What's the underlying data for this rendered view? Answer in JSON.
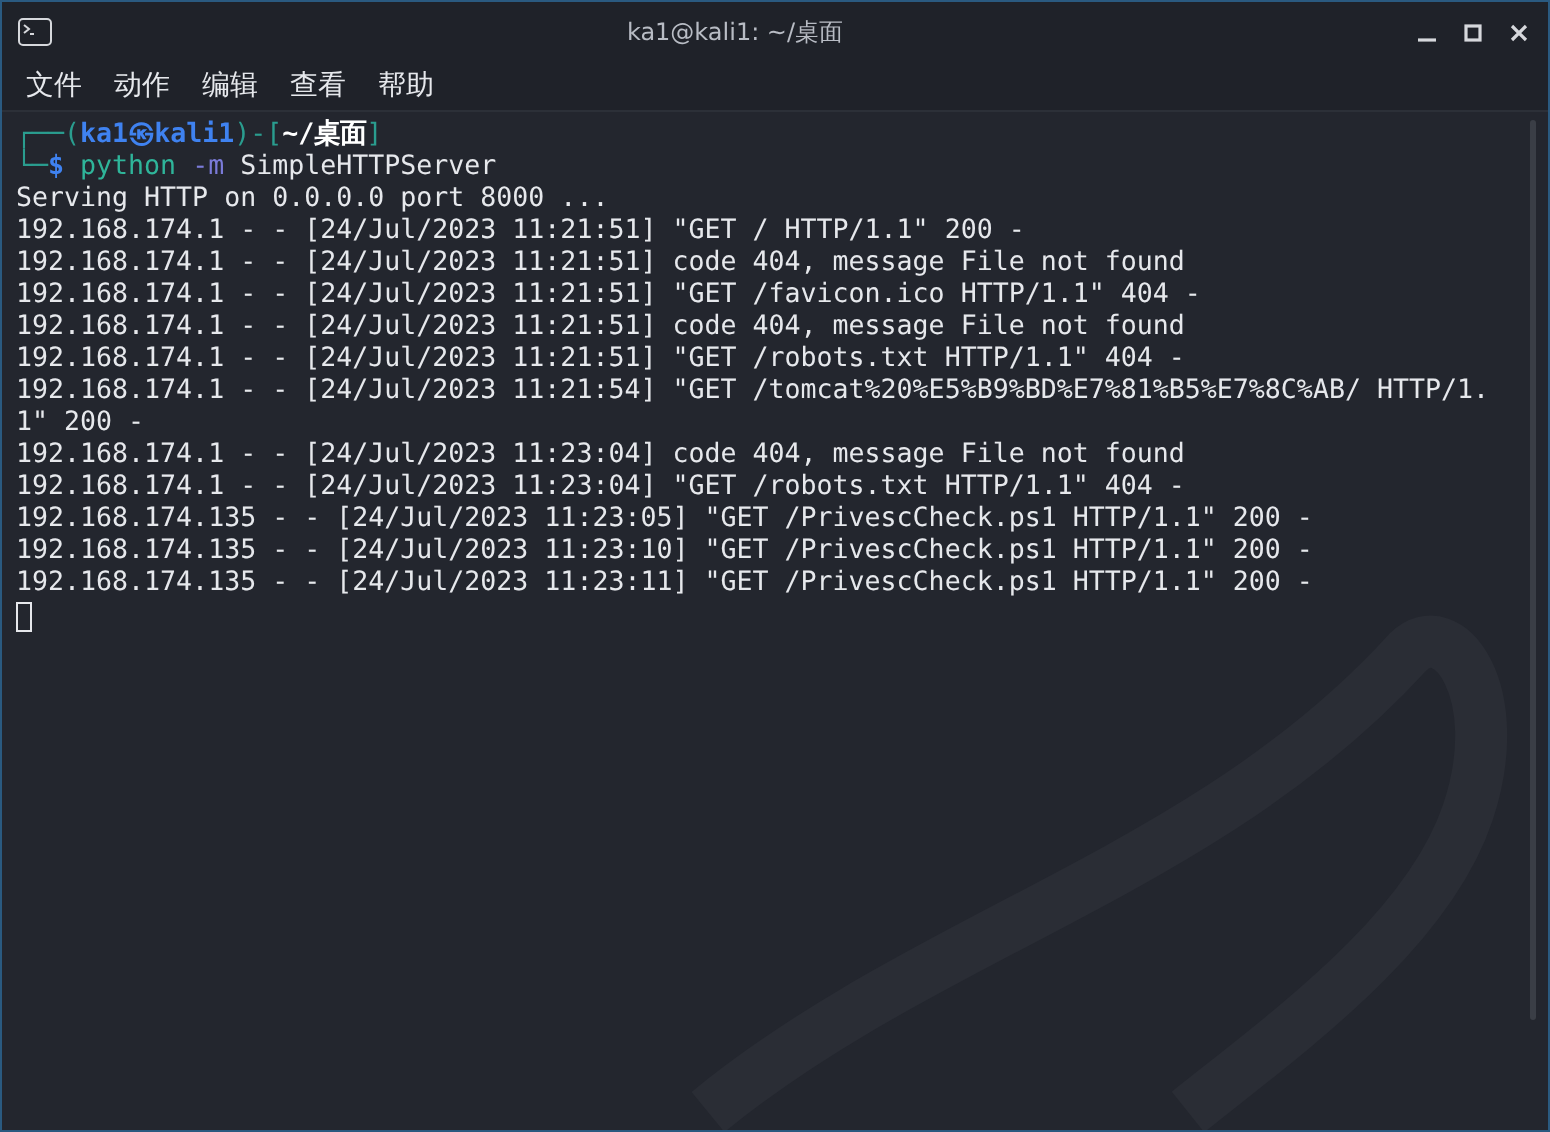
{
  "window": {
    "title": "ka1@kali1: ~/桌面"
  },
  "menu": [
    "文件",
    "动作",
    "编辑",
    "查看",
    "帮助"
  ],
  "prompt": {
    "open": "┌──(",
    "user": "ka1",
    "separator": "㉿",
    "host": "kali1",
    "middle": ")-[",
    "path": "~/桌面",
    "close": "]",
    "corner": "└─",
    "symbol": "$"
  },
  "command": {
    "program": "python",
    "option": "-m",
    "argument": "SimpleHTTPServer"
  },
  "output": [
    "Serving HTTP on 0.0.0.0 port 8000 ...",
    "192.168.174.1 - - [24/Jul/2023 11:21:51] \"GET / HTTP/1.1\" 200 -",
    "192.168.174.1 - - [24/Jul/2023 11:21:51] code 404, message File not found",
    "192.168.174.1 - - [24/Jul/2023 11:21:51] \"GET /favicon.ico HTTP/1.1\" 404 -",
    "192.168.174.1 - - [24/Jul/2023 11:21:51] code 404, message File not found",
    "192.168.174.1 - - [24/Jul/2023 11:21:51] \"GET /robots.txt HTTP/1.1\" 404 -",
    "192.168.174.1 - - [24/Jul/2023 11:21:54] \"GET /tomcat%20%E5%B9%BD%E7%81%B5%E7%8C%AB/ HTTP/1.",
    "1\" 200 -",
    "192.168.174.1 - - [24/Jul/2023 11:23:04] code 404, message File not found",
    "192.168.174.1 - - [24/Jul/2023 11:23:04] \"GET /robots.txt HTTP/1.1\" 404 -",
    "192.168.174.135 - - [24/Jul/2023 11:23:05] \"GET /PrivescCheck.ps1 HTTP/1.1\" 200 -",
    "192.168.174.135 - - [24/Jul/2023 11:23:10] \"GET /PrivescCheck.ps1 HTTP/1.1\" 200 -",
    "192.168.174.135 - - [24/Jul/2023 11:23:11] \"GET /PrivescCheck.ps1 HTTP/1.1\" 200 -"
  ]
}
